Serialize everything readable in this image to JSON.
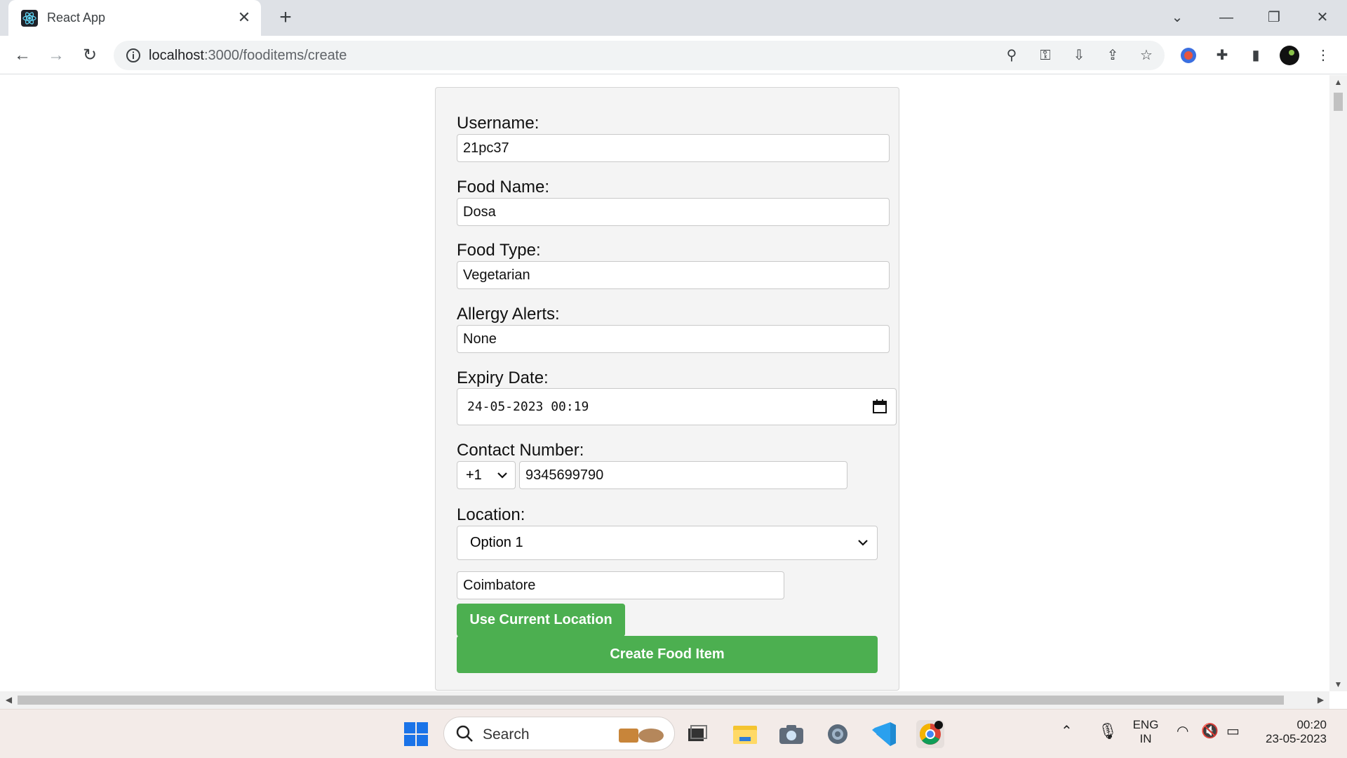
{
  "browser": {
    "tab_title": "React App",
    "url_host": "localhost",
    "url_path": ":3000/fooditems/create"
  },
  "form": {
    "username_label": "Username:",
    "username_value": "21pc37",
    "food_name_label": "Food Name:",
    "food_name_value": "Dosa",
    "food_type_label": "Food Type:",
    "food_type_value": "Vegetarian",
    "allergy_label": "Allergy Alerts:",
    "allergy_value": "None",
    "expiry_label": "Expiry Date:",
    "expiry_value": "24-05-2023 00:19",
    "contact_label": "Contact Number:",
    "country_code": "+1",
    "phone_value": "9345699790",
    "location_label": "Location:",
    "location_option": "Option 1",
    "location_text": "Coimbatore",
    "use_location_button": "Use Current Location",
    "create_button": "Create Food Item"
  },
  "taskbar": {
    "search_placeholder": "Search",
    "lang_line1": "ENG",
    "lang_line2": "IN",
    "time": "00:20",
    "date": "23-05-2023"
  },
  "colors": {
    "accent_green": "#4caf50",
    "chrome_tabstrip": "#dee1e6"
  }
}
